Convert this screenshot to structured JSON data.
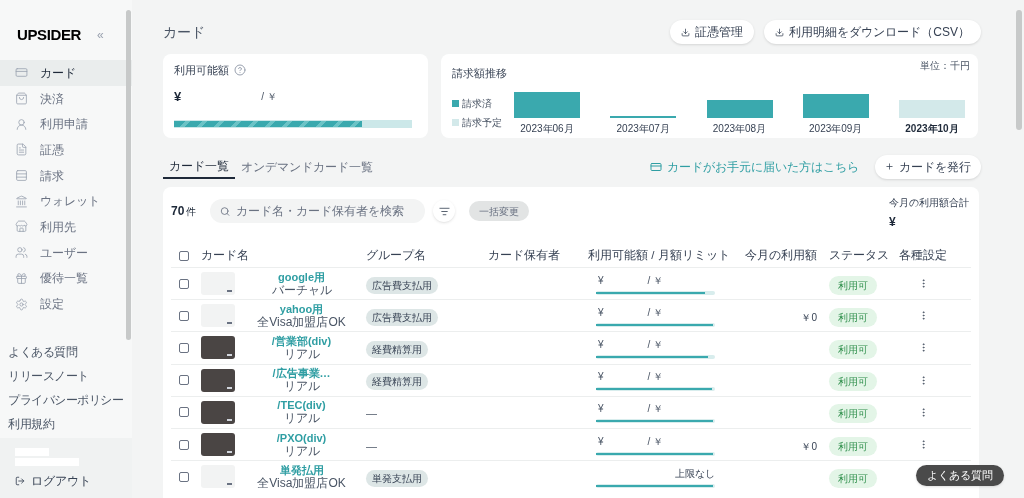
{
  "sidebar": {
    "logo": "UPSIDER",
    "collapse": "«",
    "items": [
      {
        "label": "カード",
        "selected": true
      },
      {
        "label": "決済",
        "selected": false
      },
      {
        "label": "利用申請",
        "selected": false
      },
      {
        "label": "証憑",
        "selected": false
      },
      {
        "label": "請求",
        "selected": false
      },
      {
        "label": "ウォレット",
        "selected": false
      },
      {
        "label": "利用先",
        "selected": false
      },
      {
        "label": "ユーザー",
        "selected": false
      },
      {
        "label": "優待一覧",
        "selected": false
      },
      {
        "label": "設定",
        "selected": false
      }
    ],
    "links": [
      "よくある質問",
      "リリースノート",
      "プライバシーポリシー",
      "利用規約"
    ],
    "logout": "ログアウト"
  },
  "page": {
    "title": "カード",
    "buttons": [
      "証憑管理",
      "利用明細をダウンロード（CSV）"
    ]
  },
  "available": {
    "title": "利用可能額",
    "currency": "¥",
    "separator": "/ ￥",
    "level": 0.79
  },
  "billing": {
    "title": "請求額推移",
    "unit": "単位：千円",
    "legend": [
      {
        "label": "請求済",
        "kind": "billed"
      },
      {
        "label": "請求予定",
        "kind": "scheduled"
      }
    ],
    "bars": [
      {
        "label": "2023年06月",
        "kind": "billed"
      },
      {
        "label": "2023年07月",
        "kind": "billed"
      },
      {
        "label": "2023年08月",
        "kind": "billed"
      },
      {
        "label": "2023年09月",
        "kind": "billed"
      },
      {
        "label": "2023年10月",
        "kind": "scheduled"
      }
    ]
  },
  "tabs": [
    {
      "label": "カード一覧",
      "selected": true
    },
    {
      "label": "オンデマンドカード一覧",
      "selected": false
    }
  ],
  "arrived_link": "カードがお手元に届いた方はこちら",
  "issue_button": "カードを発行",
  "toolbar": {
    "count": "70",
    "count_unit": "件",
    "search_placeholder": "カード名・カード保有者を検索",
    "bulk_button": "一括変更",
    "total_label": "今月の利用額合計",
    "total_currency": "¥"
  },
  "table": {
    "select_all_checked": false,
    "columns": [
      "カード名",
      "グループ名",
      "カード保有者",
      "利用可能額 / 月額リミット",
      "今月の利用額",
      "ステータス",
      "各種設定"
    ],
    "rows": [
      {
        "name": "google用",
        "type": "バーチャル",
        "kind": "light",
        "group": "広告費支払用",
        "limit": "¥",
        "limit_sep": "/ ￥",
        "level": 0.93,
        "usage": "",
        "status": "利用可",
        "checked": false
      },
      {
        "name": "yahoo用",
        "type": "全Visa加盟店OK",
        "kind": "light",
        "group": "広告費支払用",
        "limit": "¥",
        "limit_sep": "/ ￥",
        "level": 1,
        "usage": "￥0",
        "status": "利用可",
        "checked": false
      },
      {
        "name": "/営業部(div)",
        "type": "リアル",
        "kind": "dark",
        "group": "経費精算用",
        "limit": "¥",
        "limit_sep": "/ ￥",
        "level": 0.96,
        "usage": "",
        "status": "利用可",
        "checked": false
      },
      {
        "name": "/広告事業…",
        "type": "リアル",
        "kind": "dark",
        "group": "経費精算用",
        "limit": "¥",
        "limit_sep": "/ ￥",
        "level": 0.99,
        "usage": "",
        "status": "利用可",
        "checked": false
      },
      {
        "name": "/TEC(div)",
        "type": "リアル",
        "kind": "dark",
        "group": "—",
        "limit": "¥",
        "limit_sep": "/ ￥",
        "level": 1,
        "usage": "",
        "status": "利用可",
        "checked": false
      },
      {
        "name": "/PXO(div)",
        "type": "リアル",
        "kind": "dark",
        "group": "—",
        "limit": "¥",
        "limit_sep": "/ ￥",
        "level": 1,
        "usage": "￥0",
        "status": "利用可",
        "checked": false
      },
      {
        "name": "単発払用",
        "type": "全Visa加盟店OK",
        "kind": "light",
        "group": "単発支払用",
        "limit": "上限なし",
        "level": 1,
        "usage": "",
        "status": "利用可",
        "checked": false,
        "menu_visible": false
      }
    ]
  },
  "help_button": "よくある質問"
}
